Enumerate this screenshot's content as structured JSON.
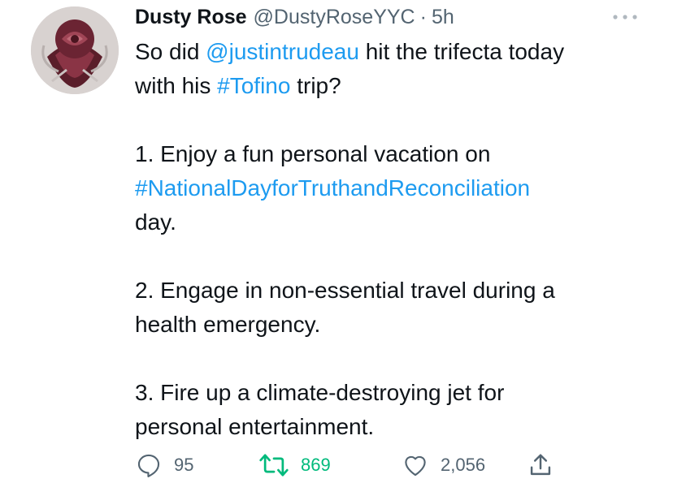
{
  "tweet": {
    "display_name": "Dusty Rose",
    "handle": "@DustyRoseYYC",
    "separator": "·",
    "time": "5h",
    "avatar_icon": "rose-avatar-icon",
    "more_icon": "more-options-icon",
    "text": {
      "line1_a": "So did ",
      "mention": "@justintrudeau",
      "line1_b": " hit the trifecta today",
      "line2_a": "with his ",
      "hashtag1": "#Tofino",
      "line2_b": " trip?",
      "item1_a": "1. Enjoy a fun personal vacation on",
      "hashtag2": "#NationalDayforTruthandReconciliation",
      "item1_c": "day.",
      "item2_a": "2.  Engage in non-essential travel during a",
      "item2_b": "health emergency.",
      "item3_a": "3.  Fire up a climate-destroying jet for",
      "item3_b": "personal entertainment."
    },
    "actions": {
      "replies": "95",
      "retweets": "869",
      "likes": "2,056",
      "reply_icon": "reply-icon",
      "retweet_icon": "retweet-icon",
      "like_icon": "heart-icon",
      "share_icon": "share-icon"
    },
    "colors": {
      "link": "#1d9bf0",
      "secondary": "#536471",
      "retweet_active": "#00ba7c",
      "text": "#0f1419"
    }
  }
}
